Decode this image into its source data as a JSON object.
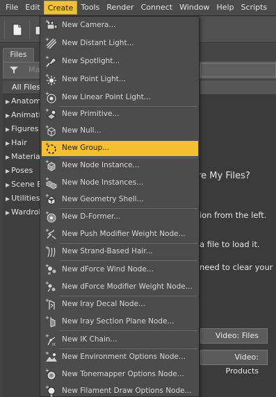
{
  "menubar": {
    "items": [
      "File",
      "Edit",
      "Create",
      "Tools",
      "Render",
      "Connect",
      "Window",
      "Help",
      "Scripts"
    ],
    "active": "Create"
  },
  "pane": {
    "tab_label": "Files",
    "filter_placeholder": "Ma",
    "category_header": "All Files",
    "categories": [
      "Anatomy",
      "Animation",
      "Figures",
      "Hair",
      "Materials",
      "Poses",
      "Scene B",
      "Utilities",
      "Wardrob"
    ],
    "info_title": "re Are My Files?",
    "info_line1": "ion from the left.",
    "info_line2": "a file to load it.",
    "info_line3": "need to clear your ke",
    "video_files": "Video: Files",
    "video_products": "Video:  Products"
  },
  "create_menu": {
    "items": [
      {
        "label": "New Camera...",
        "icon": "camera-icon"
      },
      {
        "label": "New Distant Light...",
        "icon": "distant-light-icon"
      },
      {
        "label": "New Spotlight...",
        "icon": "spotlight-icon"
      },
      {
        "label": "New Point Light...",
        "icon": "point-light-icon"
      },
      {
        "label": "New Linear Point Light...",
        "icon": "linear-point-light-icon"
      },
      {
        "label": "New Primitive...",
        "icon": "primitive-icon"
      },
      {
        "label": "New Null...",
        "icon": "null-icon"
      },
      {
        "label": "New Group...",
        "icon": "group-icon"
      },
      {
        "label": "New Node Instance...",
        "icon": "node-instance-icon"
      },
      {
        "label": "New Node Instances...",
        "icon": "node-instances-icon"
      },
      {
        "label": "New Geometry Shell...",
        "icon": "geometry-shell-icon"
      },
      {
        "label": "New D-Former...",
        "icon": "dformer-icon"
      },
      {
        "label": "New Push Modifier Weight Node...",
        "icon": "push-modifier-icon"
      },
      {
        "label": "New Strand-Based Hair...",
        "icon": "strand-hair-icon"
      },
      {
        "label": "New dForce Wind Node...",
        "icon": "dforce-wind-icon"
      },
      {
        "label": "New dForce Modifier Weight Node...",
        "icon": "dforce-modifier-icon"
      },
      {
        "label": "New Iray Decal Node...",
        "icon": "iray-decal-icon"
      },
      {
        "label": "New Iray Section Plane Node...",
        "icon": "iray-section-plane-icon"
      },
      {
        "label": "New IK Chain...",
        "icon": "ik-chain-icon"
      },
      {
        "label": "New Environment Options Node...",
        "icon": "environment-options-icon"
      },
      {
        "label": "New Tonemapper Options Node...",
        "icon": "tonemapper-options-icon"
      },
      {
        "label": "New Filament Draw Options Node...",
        "icon": "filament-draw-options-icon"
      }
    ],
    "highlighted": "New Group...",
    "highlight_color": "#f5c030"
  }
}
